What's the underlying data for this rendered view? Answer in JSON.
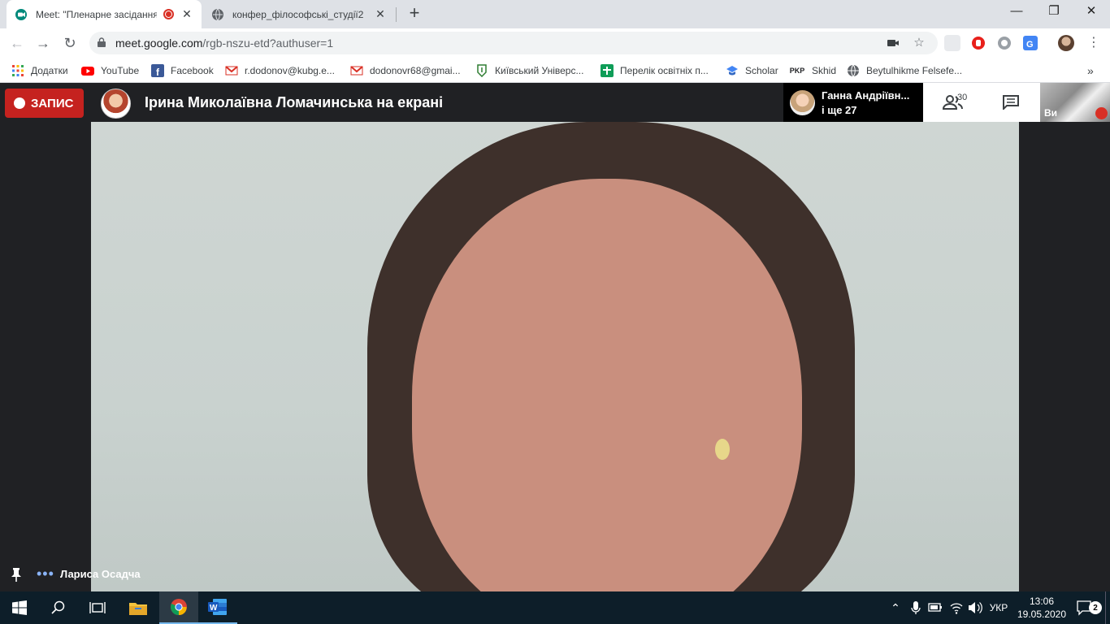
{
  "browser": {
    "tabs": [
      {
        "title": "Meet: \"Пленарне засідання",
        "close": "✕"
      },
      {
        "title": "конфер_філософські_студії2",
        "close": "✕"
      }
    ],
    "new_tab": "+",
    "window_controls": {
      "minimize": "—",
      "maximize": "❐",
      "close": "✕"
    },
    "nav": {
      "back": "←",
      "forward": "→",
      "reload": "↻"
    },
    "url_host": "meet.google.com",
    "url_path": "/rgb-nszu-etd?authuser=1",
    "bookmarks": [
      {
        "label": "Додатки",
        "icon": "apps-grid-icon"
      },
      {
        "label": "YouTube",
        "icon": "youtube-icon"
      },
      {
        "label": "Facebook",
        "icon": "facebook-icon"
      },
      {
        "label": "r.dodonov@kubg.e...",
        "icon": "gmail-icon"
      },
      {
        "label": "dodonovr68@gmai...",
        "icon": "gmail-icon"
      },
      {
        "label": "Київський Універс...",
        "icon": "university-icon"
      },
      {
        "label": "Перелік освітніх п...",
        "icon": "green-cross-icon"
      },
      {
        "label": "Scholar",
        "icon": "scholar-icon"
      },
      {
        "label": "Skhid",
        "icon": "pkp-icon",
        "icon_text": "PKP"
      },
      {
        "label": "Beytulhikme Felsefe...",
        "icon": "globe-icon"
      }
    ],
    "bookmarks_more": "»"
  },
  "meet": {
    "recording_label": "ЗАПИС",
    "presenter_title": "Ірина Миколаївна Ломачинська на екрані",
    "participants_preview_name": "Ганна Андріївн...",
    "participants_preview_more": "і ще 27",
    "participant_count": "30",
    "self_label": "Ви",
    "speaker_name": "Лариса Осадча",
    "speaking_dots": "•••"
  },
  "taskbar": {
    "language": "УКР",
    "time": "13:06",
    "date": "19.05.2020",
    "notification_count": "2"
  },
  "colors": {
    "record_red": "#c5221f",
    "meet_bg": "#202124",
    "taskbar_bg": "#0d1e29",
    "speaking_blue": "#8ab4f8"
  }
}
